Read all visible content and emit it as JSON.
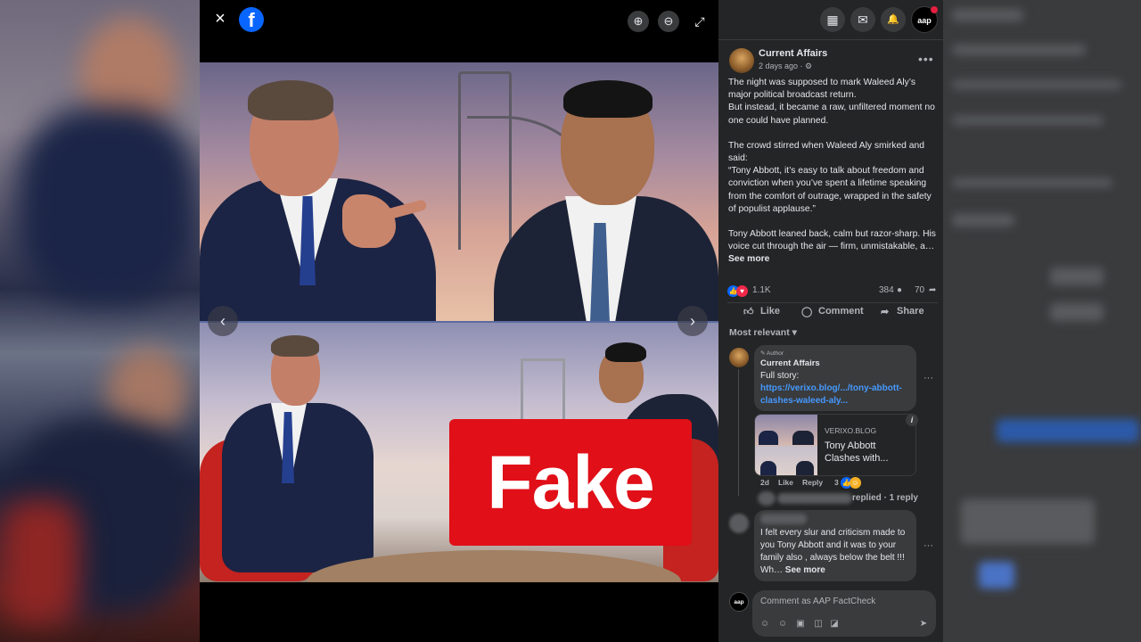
{
  "viewer": {
    "close_icon": "×",
    "fb_logo": "f",
    "zoom_in_icon": "⊕",
    "zoom_out_icon": "⊖",
    "expand_icon": "⤢",
    "prev_icon": "‹",
    "next_icon": "›",
    "overlay_label": "Fake"
  },
  "topbar": {
    "menu_icon": "▦",
    "messenger_icon": "✉",
    "bell_icon": "🔔",
    "profile_label": "aap"
  },
  "post": {
    "page_name": "Current Affairs",
    "time": "2 days ago · ⚙",
    "paragraphs": [
      "The night was supposed to mark Waleed Aly’s major political broadcast return.\nBut instead, it became a raw, unfiltered moment no one could have planned.",
      "The crowd stirred when Waleed Aly smirked and said:\n“Tony Abbott, it’s easy to talk about freedom and conviction when you’ve spent a lifetime speaking from the comfort of outrage, wrapped in the safety of populist applause.”"
    ],
    "last_paragraph": "Tony Abbott leaned back, calm but razor-sharp. His voice cut through the air — firm, unmistakable, a… ",
    "see_more": "See more",
    "reactions_count": "1.1K",
    "comments_count": "384",
    "shares_count": "70",
    "like_label": "Like",
    "comment_label": "Comment",
    "share_label": "Share",
    "sort_label": "Most relevant ▾"
  },
  "comments": [
    {
      "badge": "✎ Author",
      "name": "Current Affairs",
      "text": "Full story:",
      "link": "https://verixo.blog/.../tony-abbott-clashes-waleed-aly...",
      "card_domain": "VERIXO.BLOG",
      "card_title": "Tony Abbott Clashes with...",
      "time": "2d",
      "like": "Like",
      "reply": "Reply",
      "reaction_count": "3",
      "replies_text": "replied · 1 reply"
    },
    {
      "text": "I felt every slur and criticism made to you Tony Abbott and it was to your family also , always below the belt !!! Wh… ",
      "see_more": "See more"
    }
  ],
  "composer": {
    "avatar_label": "aap",
    "placeholder": "Comment as AAP FactCheck"
  },
  "colors": {
    "facebook_blue": "#0866ff",
    "fake_red": "#e00f18",
    "panel_bg": "#242526",
    "link_blue": "#4599ff"
  }
}
